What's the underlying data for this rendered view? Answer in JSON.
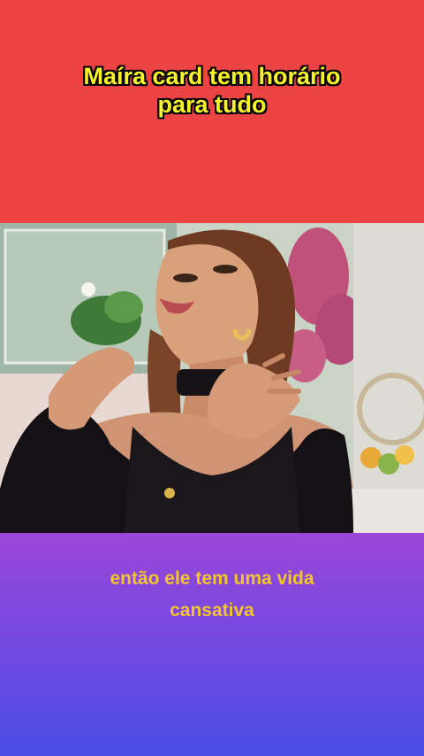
{
  "title": {
    "line1": "Maíra card tem horário",
    "line2": "para tudo"
  },
  "caption": {
    "line1": "então ele tem uma vida",
    "line2": "cansativa"
  },
  "colors": {
    "top_band": "#ec4443",
    "title_text": "#fbf32a",
    "caption_text": "#f2c52a",
    "gradient_top": "#9b46d6",
    "gradient_bottom": "#4a4de6"
  }
}
